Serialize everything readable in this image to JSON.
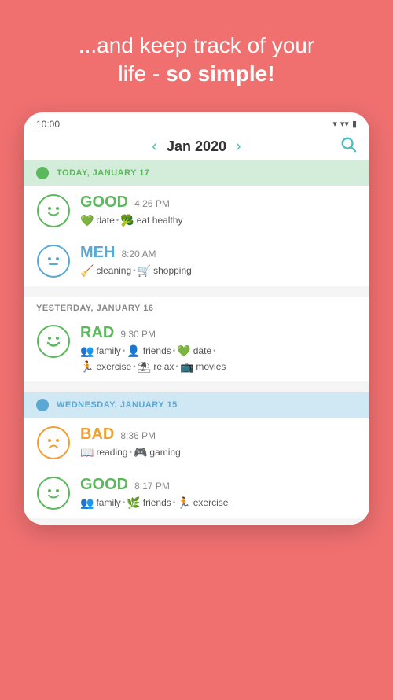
{
  "header": {
    "line1": "...and keep track of your",
    "line2_normal": "life - ",
    "line2_bold": "so simple!"
  },
  "statusBar": {
    "time": "10:00",
    "icons": "▾ ▾ ▮"
  },
  "navBar": {
    "prevArrow": "‹",
    "nextArrow": "›",
    "monthYear": "Jan 2020",
    "searchIcon": "🔍"
  },
  "days": [
    {
      "id": "today",
      "label": "TODAY, JANUARY 17",
      "dotColor": "green",
      "labelColor": "today-color",
      "headerClass": "today",
      "entries": [
        {
          "mood": "GOOD",
          "moodClass": "mood-good",
          "faceClass": "face-good",
          "faceEmoji": "😊",
          "time": "4:26 PM",
          "tags": [
            {
              "icon": "💚",
              "label": "date"
            },
            {
              "icon": "🥦",
              "label": "eat healthy"
            }
          ]
        },
        {
          "mood": "MEH",
          "moodClass": "mood-meh",
          "faceClass": "face-meh",
          "faceEmoji": "😐",
          "time": "8:20 AM",
          "tags": [
            {
              "icon": "🧹",
              "label": "cleaning"
            },
            {
              "icon": "🛒",
              "label": "shopping"
            }
          ]
        }
      ]
    },
    {
      "id": "yesterday",
      "label": "YESTERDAY, JANUARY 16",
      "entries": [
        {
          "mood": "RAD",
          "moodClass": "mood-rad",
          "faceClass": "face-rad",
          "faceEmoji": "😄",
          "time": "9:30 PM",
          "tags": [
            {
              "icon": "👥",
              "label": "family"
            },
            {
              "icon": "👥",
              "label": "friends"
            },
            {
              "icon": "💚",
              "label": "date"
            },
            {
              "icon": "🏃",
              "label": "exercise"
            },
            {
              "icon": "⛱",
              "label": "relax"
            },
            {
              "icon": "📺",
              "label": "movies"
            }
          ]
        }
      ]
    },
    {
      "id": "wednesday",
      "label": "WEDNESDAY, JANUARY 15",
      "dotColor": "blue",
      "labelColor": "wed-color",
      "headerClass": "wednesday",
      "entries": [
        {
          "mood": "BAD",
          "moodClass": "mood-bad",
          "faceClass": "face-bad",
          "faceEmoji": "😟",
          "time": "8:36 PM",
          "tags": [
            {
              "icon": "📖",
              "label": "reading"
            },
            {
              "icon": "🎮",
              "label": "gaming"
            }
          ]
        },
        {
          "mood": "GOOD",
          "moodClass": "mood-good2",
          "faceClass": "face-good2",
          "faceEmoji": "😊",
          "time": "8:17 PM",
          "tags": [
            {
              "icon": "👥",
              "label": "family"
            },
            {
              "icon": "🌿",
              "label": "friends"
            },
            {
              "icon": "🏃",
              "label": "exercise"
            }
          ]
        }
      ]
    }
  ]
}
